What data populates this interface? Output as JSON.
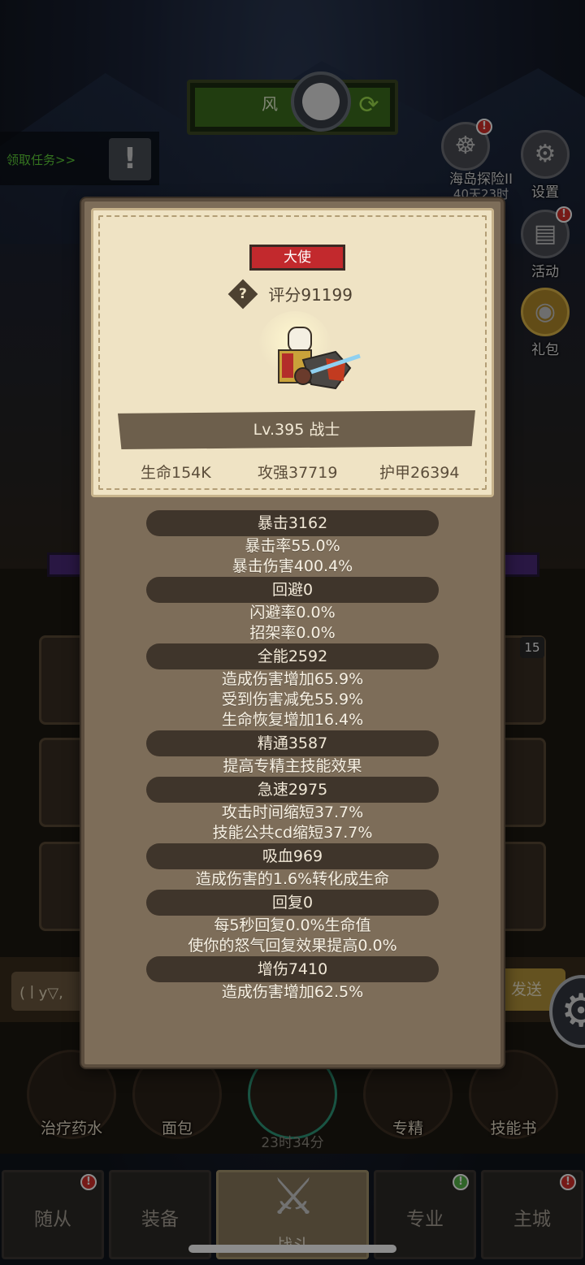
{
  "hud": {
    "top_title": "风",
    "task_link": "领取任务>>",
    "island": {
      "label": "海岛探险II",
      "timer": "40天23时"
    },
    "settings_label": "设置",
    "activity_label": "活动",
    "gift_label": "礼包",
    "item_count": "15",
    "chat_placeholder": "(ￜy▽,",
    "send_label": "发送",
    "actions": [
      {
        "label": "治疗药水"
      },
      {
        "label": "面包"
      },
      {
        "label": "专精"
      },
      {
        "label": "技能书"
      }
    ],
    "chest_timer": "23时34分",
    "nav": {
      "followers": "随从",
      "equipment": "装备",
      "battle": "战斗",
      "profession": "专业",
      "main_city": "主城"
    }
  },
  "profile": {
    "rank": "大使",
    "score": "评分91199",
    "level_class": "Lv.395 战士",
    "hp": "生命154K",
    "attack_power": "攻强37719",
    "armor": "护甲26394"
  },
  "stats": [
    {
      "title": "暴击3162",
      "lines": [
        "暴击率55.0%",
        "暴击伤害400.4%"
      ]
    },
    {
      "title": "回避0",
      "lines": [
        "闪避率0.0%",
        "招架率0.0%"
      ]
    },
    {
      "title": "全能2592",
      "lines": [
        "造成伤害增加65.9%",
        "受到伤害减免55.9%",
        "生命恢复增加16.4%"
      ]
    },
    {
      "title": "精通3587",
      "lines": [
        "提高专精主技能效果"
      ]
    },
    {
      "title": "急速2975",
      "lines": [
        "攻击时间缩短37.7%",
        "技能公共cd缩短37.7%"
      ]
    },
    {
      "title": "吸血969",
      "lines": [
        "造成伤害的1.6%转化成生命"
      ]
    },
    {
      "title": "回复0",
      "lines": [
        "每5秒回复0.0%生命值",
        "使你的怒气回复效果提高0.0%"
      ]
    },
    {
      "title": "增伤7410",
      "lines": [
        "造成伤害增加62.5%"
      ]
    }
  ],
  "colors": {
    "panel_bg": "#7d6d59",
    "parchment": "#efe3c4",
    "rank_red": "#c2292d",
    "group_head": "#3f352b"
  }
}
